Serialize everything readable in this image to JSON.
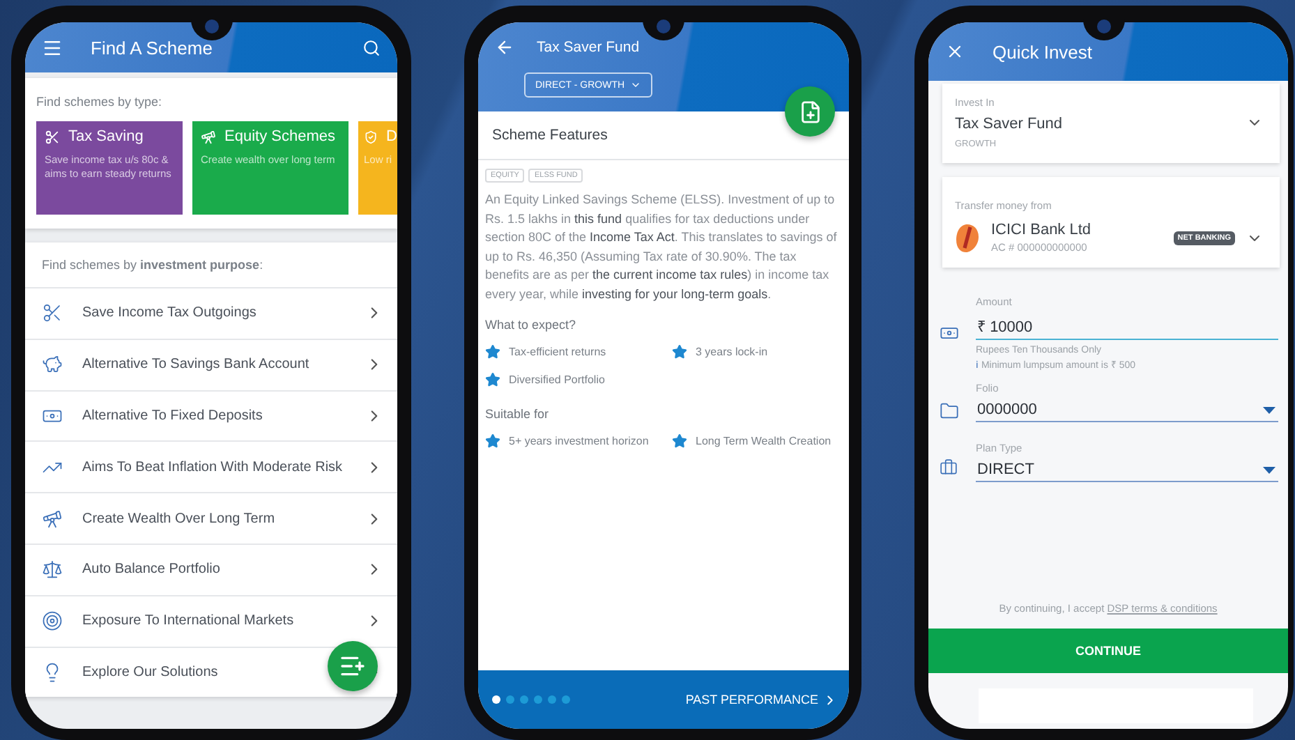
{
  "find_scheme": {
    "title": "Find A Scheme",
    "type_heading": "Find schemes by type:",
    "types": [
      {
        "title": "Tax Saving",
        "description": "Save income tax u/s 80c & aims to earn steady returns",
        "color": "#7b4a9e"
      },
      {
        "title": "Equity Schemes",
        "description": "Create wealth over long term",
        "color": "#1aab4b"
      },
      {
        "title": "D",
        "description": "Low ri",
        "color": "#f5b51e"
      }
    ],
    "purpose_heading": "Find schemes by **investment purpose**:",
    "purposes": [
      "Save Income Tax Outgoings",
      "Alternative To Savings Bank Account",
      "Alternative To Fixed Deposits",
      "Aims To Beat Inflation With Moderate Risk",
      "Create Wealth Over Long Term",
      "Auto Balance Portfolio",
      "Exposure To International Markets",
      "Explore Our Solutions"
    ]
  },
  "fund_details": {
    "title": "Tax Saver Fund",
    "plan_chip": "DIRECT - GROWTH",
    "section_title": "Scheme Features",
    "tags": [
      "EQUITY",
      "ELSS FUND"
    ],
    "description": "An Equity Linked Savings Scheme (ELSS). Investment of up to Rs. 1.5 lakhs in **this fund** qualifies for tax deductions under section 80C of the **Income Tax Act**. This translates to savings of up to Rs. 46,350 (Assuming Tax rate of 30.90%. The tax benefits are as per **the current income tax rules**) in income tax every year, while **investing for your long-term goals**.",
    "expect_heading": "What to expect?",
    "expectations": [
      "Tax-efficient returns",
      "3 years lock-in",
      "Diversified Portfolio"
    ],
    "suitable_heading": "Suitable for",
    "suitable": [
      "5+ years investment horizon",
      "Long Term Wealth Creation"
    ],
    "page_dots": [
      {
        "selected": true
      },
      {
        "selected": false
      },
      {
        "selected": false
      },
      {
        "selected": false
      },
      {
        "selected": false
      },
      {
        "selected": false
      }
    ],
    "next_link": "PAST PERFORMANCE"
  },
  "quick_invest": {
    "title": "Quick Invest",
    "invest_in": {
      "label": "Invest In",
      "fund": "Tax Saver Fund",
      "option": "GROWTH"
    },
    "transfer": {
      "label": "Transfer money from",
      "bank": "ICICI Bank Ltd",
      "account": "AC # 000000000000",
      "badge": "NET BANKING"
    },
    "amount": {
      "label": "Amount",
      "currency": "₹",
      "value": "10000",
      "words": "Rupees Ten Thousands Only",
      "info_icon": "ℹ",
      "minimum": "Minimum lumpsum amount is ₹ 500"
    },
    "folio": {
      "label": "Folio",
      "value": "0000000"
    },
    "plan_type": {
      "label": "Plan Type",
      "value": "DIRECT"
    },
    "terms": {
      "text": "By continuing, I accept",
      "link": "DSP terms & conditions"
    },
    "button": "CONTINUE"
  }
}
